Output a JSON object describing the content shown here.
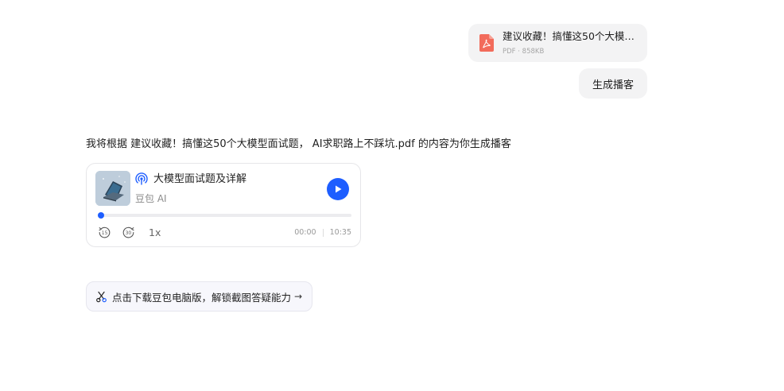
{
  "file": {
    "name": "建议收藏！搞懂这50个大模型面试题，AI求职路上不踩坑.pdf",
    "meta": "PDF · 858KB",
    "icon": "pdf-icon"
  },
  "user_message": "生成播客",
  "assistant_message": "我将根据 建议收藏！搞懂这50个大模型面试题， AI求职路上不踩坑.pdf 的内容为你生成播客",
  "podcast": {
    "title": "大模型面试题及详解",
    "author": "豆包 AI",
    "speed": "1x",
    "current_time": "00:00",
    "duration": "10:35",
    "progress": 0.0,
    "rewind_label": "15",
    "forward_label": "30",
    "accent_color": "#1e5eff",
    "icons": [
      "podcast-icon",
      "play-icon",
      "rewind-15-icon",
      "forward-30-icon"
    ]
  },
  "download_banner": {
    "label": "点击下载豆包电脑版，解锁截图答疑能力",
    "arrow": "→",
    "icon": "scissors-icon"
  }
}
